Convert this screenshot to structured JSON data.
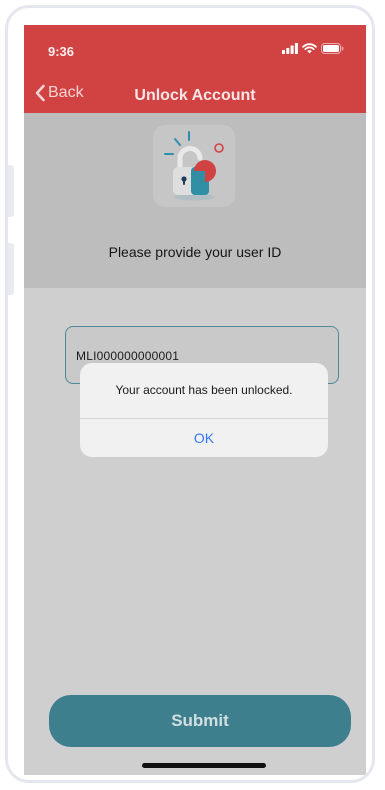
{
  "status_bar": {
    "time": "9:36"
  },
  "nav": {
    "back_label": "Back",
    "title": "Unlock Account"
  },
  "content": {
    "illustration_icon": "unlock-padlock-icon",
    "instruction": "Please provide your user ID",
    "user_id_value": "MLI000000000001"
  },
  "alert": {
    "message": "Your account has been unlocked.",
    "ok_label": "OK"
  },
  "actions": {
    "submit_label": "Submit"
  },
  "colors": {
    "header": "#d14243",
    "primary_button": "#3d7f8c",
    "alert_link": "#3478f6"
  }
}
